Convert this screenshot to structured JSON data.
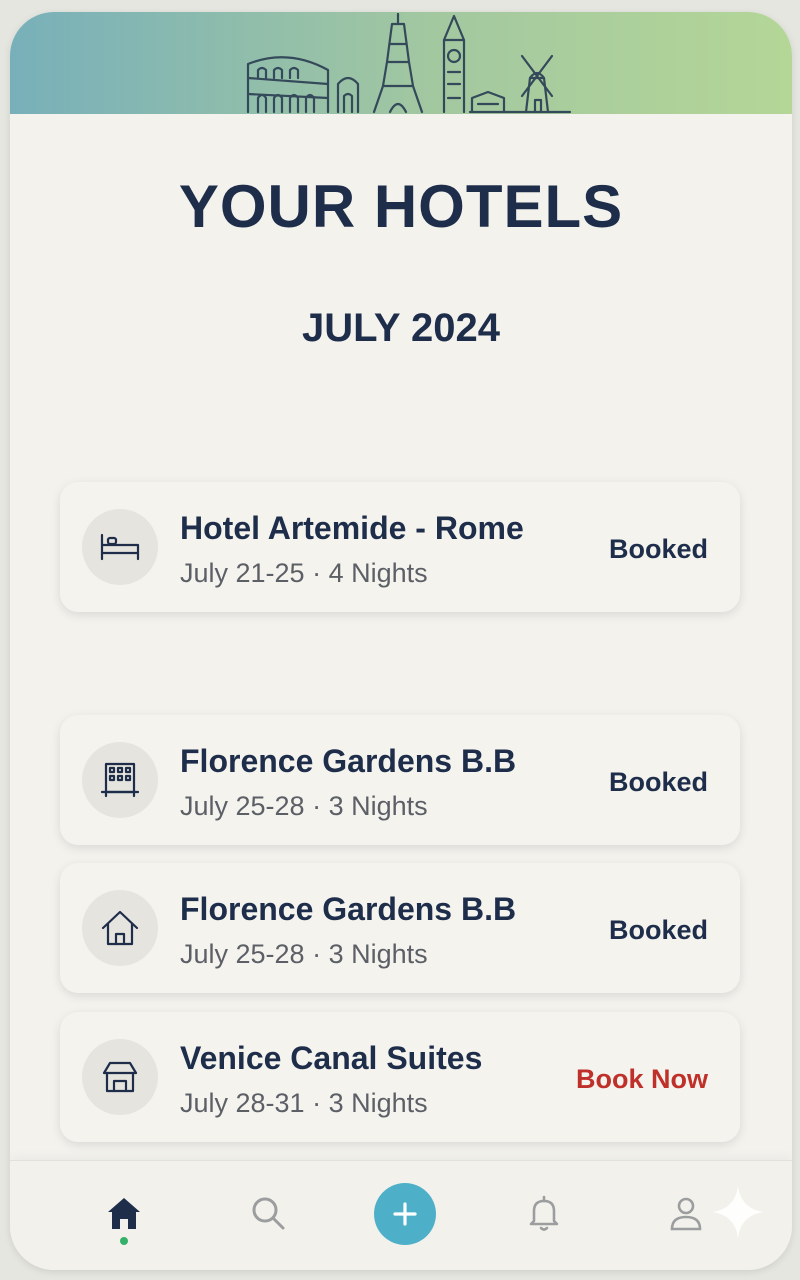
{
  "page": {
    "title": "YOUR HOTELS",
    "subtitle": "JULY 2024"
  },
  "hotels": [
    {
      "name": "Hotel Artemide - Rome",
      "dates": "July 21-25 · 4 Nights",
      "status": "Booked",
      "icon": "bed-icon"
    },
    {
      "name": "Florence Gardens B.B",
      "dates": "July 25-28 · 3 Nights",
      "status": "Booked",
      "icon": "building-icon"
    },
    {
      "name": "Florence Gardens B.B",
      "dates": "July 25-28 · 3 Nights",
      "status": "Booked",
      "icon": "house-icon"
    },
    {
      "name": "Venice Canal Suites",
      "dates": "July 28-31 · 3 Nights",
      "status": "Book Now",
      "icon": "store-icon"
    }
  ],
  "nav": {
    "items": [
      "home-icon",
      "search-icon",
      "add-icon",
      "bell-icon",
      "profile-icon"
    ],
    "active": "home"
  },
  "colors": {
    "title": "#1e2d4a",
    "book_now": "#c0302a",
    "fab": "#4eb0c8",
    "active_dot": "#34b06a",
    "banner_start": "#78b0ba",
    "banner_end": "#b4d697"
  }
}
